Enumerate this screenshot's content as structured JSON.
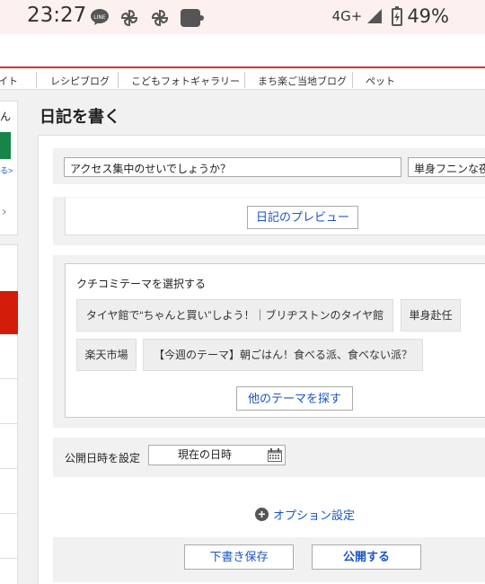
{
  "status_bar": {
    "time": "23:27",
    "network": "4G+",
    "battery": "49%",
    "icons": [
      "line-icon",
      "pinwheel-icon",
      "pinwheel-icon",
      "app-icon",
      "signal-icon",
      "battery-charging-icon"
    ]
  },
  "nav": {
    "items": [
      "イト",
      "レシピブログ",
      "こどもフォトギャラリー",
      "まち楽ご当地ブログ",
      "ペット"
    ]
  },
  "sidebar": {
    "partial_text": "ん",
    "partial_link": "る>",
    "chevron": "›"
  },
  "page": {
    "title": "日記を書く"
  },
  "editor": {
    "title_value": "アクセス集中のせいでしょうか？",
    "category_value": "単身フニンな夜",
    "preview_button": "日記のプレビュー"
  },
  "themes": {
    "label": "クチコミテーマを選択する",
    "chips": [
      "タイヤ館で“ちゃんと買い”しよう！｜ブリヂストンのタイヤ館",
      "単身赴任",
      "楽天市場",
      "【今週のテーマ】朝ごはん！食べる派、食べない派？"
    ],
    "more_button": "他のテーマを探す"
  },
  "publish_date": {
    "label": "公開日時を設定",
    "value": "現在の日時"
  },
  "options": {
    "label": "オプション設定"
  },
  "actions": {
    "draft": "下書き保存",
    "publish": "公開する"
  },
  "colors": {
    "accent_red": "#d9302b",
    "link_blue": "#1a55c4",
    "green": "#168547",
    "sidebar_red": "#d21b08"
  }
}
